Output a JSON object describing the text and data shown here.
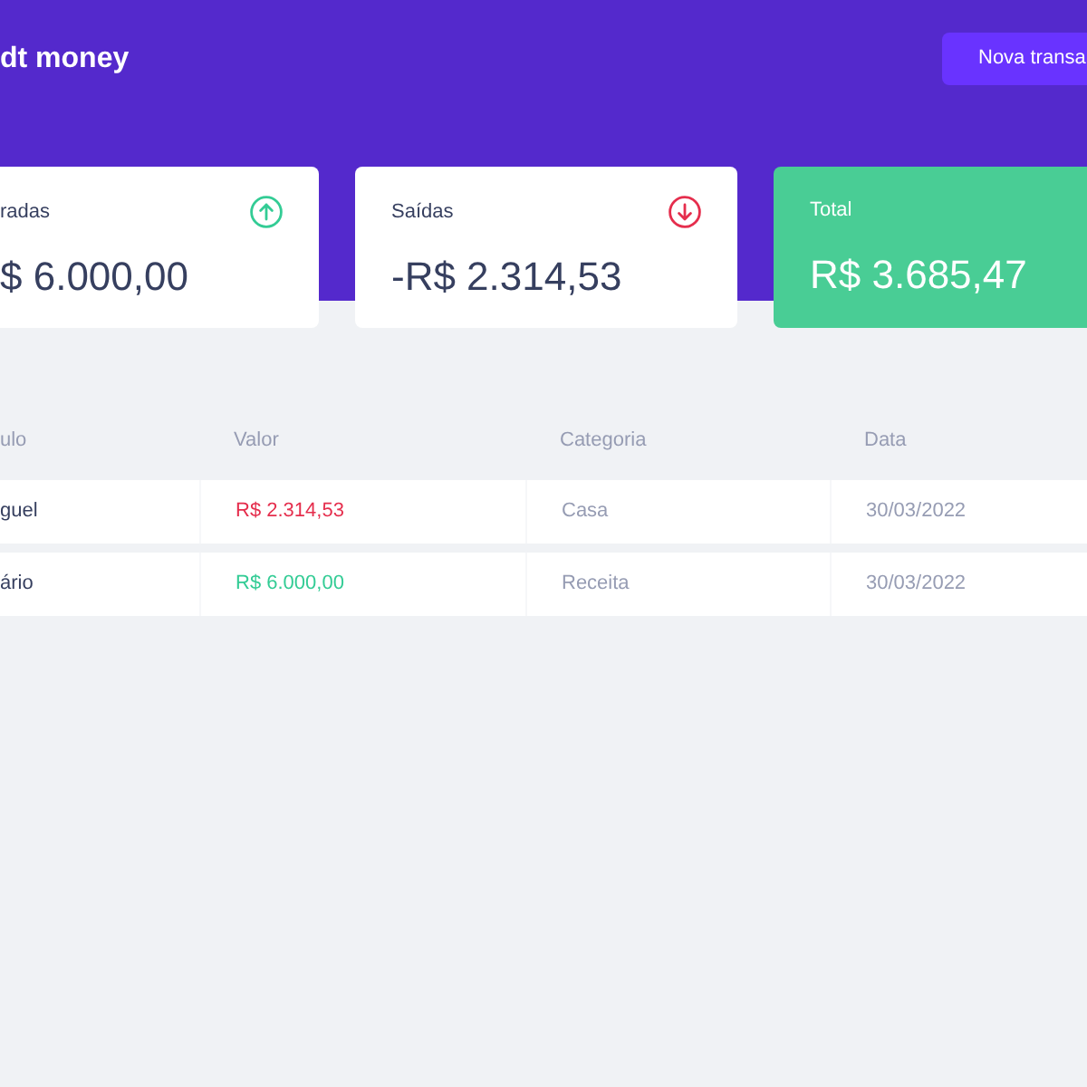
{
  "header": {
    "title": "dt money",
    "new_transaction_button": "Nova transa"
  },
  "summary": [
    {
      "kind": "income",
      "label": "radas",
      "value": "$ 6.000,00"
    },
    {
      "kind": "outcome",
      "label": "Saídas",
      "value": "-R$ 2.314,53"
    },
    {
      "kind": "total",
      "label": "Total",
      "value": "R$ 3.685,47"
    }
  ],
  "transactions": {
    "columns": [
      "ulo",
      "Valor",
      "Categoria",
      "Data"
    ],
    "rows": [
      {
        "kind": "withdraw",
        "title": "guel",
        "amount": "R$ 2.314,53",
        "category": "Casa",
        "date": "30/03/2022"
      },
      {
        "kind": "deposit",
        "title": "ário",
        "amount": "R$ 6.000,00",
        "category": "Receita",
        "date": "30/03/2022"
      }
    ]
  }
}
